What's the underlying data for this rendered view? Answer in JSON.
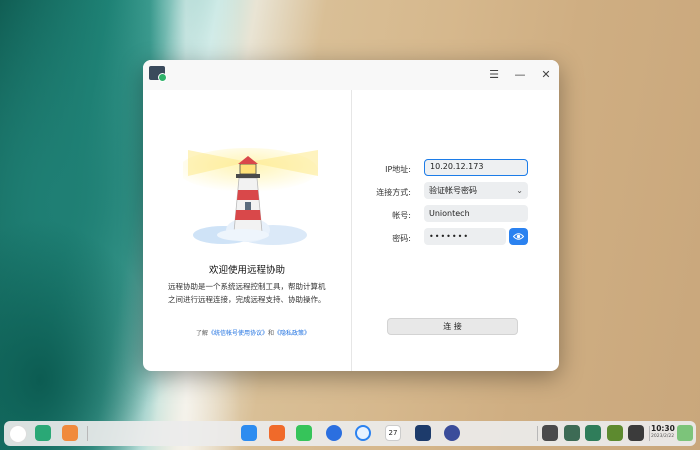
{
  "window": {
    "menu_icon": "☰",
    "minimize_icon": "—",
    "close_icon": "✕"
  },
  "intro": {
    "title": "欢迎使用远程协助",
    "description": "远程协助是一个系统远程控制工具，帮助计算机之间进行远程连接，完成远程支持、协助操作。",
    "legal_prefix": "了解",
    "legal_link1": "《统信帐号使用协议》",
    "legal_and": "和",
    "legal_link2": "《隐私政策》"
  },
  "form": {
    "ip_label": "IP地址:",
    "ip_value": "10.20.12.173",
    "method_label": "连接方式:",
    "method_value": "验证帐号密码",
    "account_label": "帐号:",
    "account_value": "Uniontech",
    "password_label": "密码:",
    "password_value": "•••••••",
    "connect_label": "连 接"
  },
  "dock": {
    "time": "10:30",
    "date": "2023/2/22",
    "calendar_day": "27"
  }
}
